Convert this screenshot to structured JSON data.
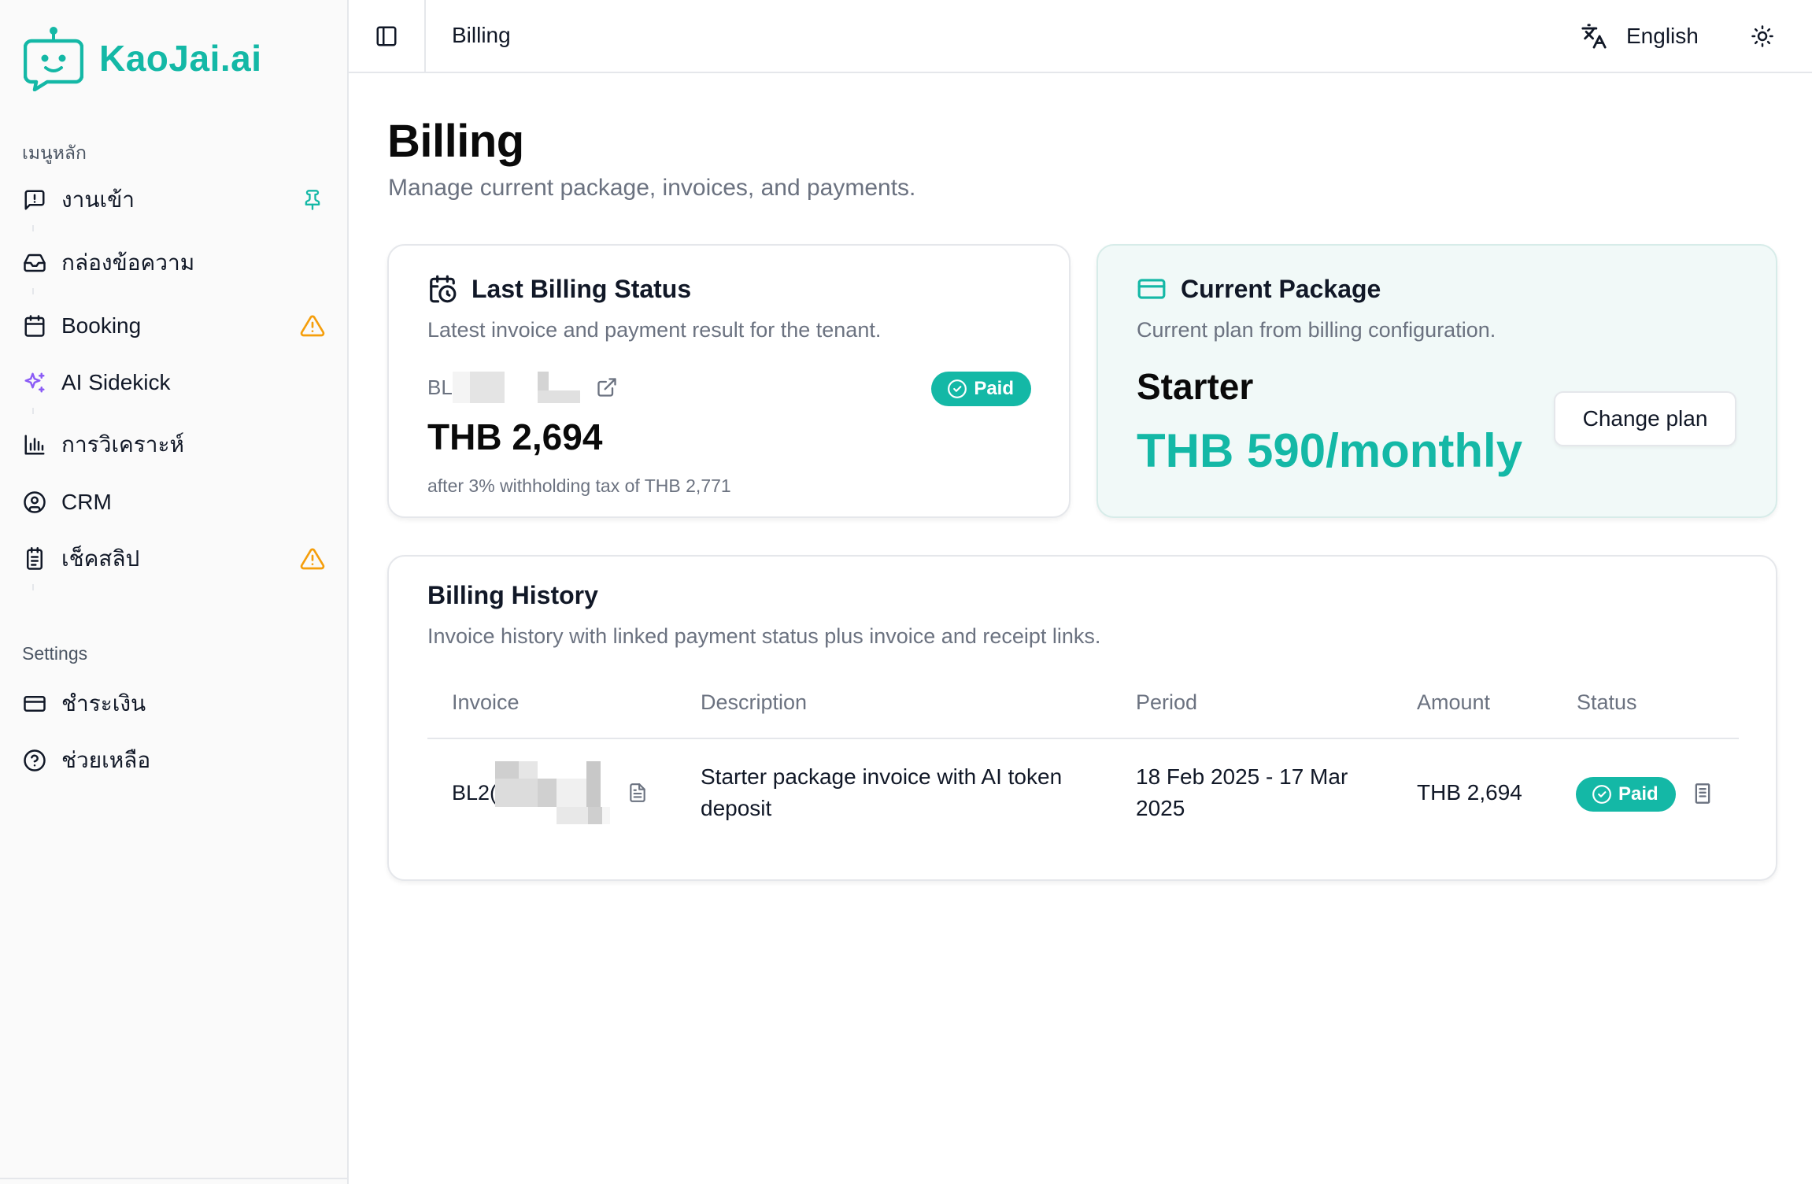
{
  "brand": {
    "name": "KaoJai.ai",
    "accent_color": "#14b8a6"
  },
  "sidebar": {
    "main_section_label": "เมนูหลัก",
    "settings_section_label": "Settings",
    "items": [
      {
        "label": "งานเข้า",
        "icon": "message-alert-icon",
        "badge": "pin-icon"
      },
      {
        "label": "กล่องข้อความ",
        "icon": "inbox-icon"
      },
      {
        "label": "Booking",
        "icon": "calendar-icon",
        "badge": "warning-icon"
      },
      {
        "label": "AI Sidekick",
        "icon": "sparkles-icon"
      },
      {
        "label": "การวิเคราะห์",
        "icon": "bar-chart-icon"
      },
      {
        "label": "CRM",
        "icon": "user-circle-icon"
      },
      {
        "label": "เช็คสลิป",
        "icon": "clipboard-icon",
        "badge": "warning-icon"
      }
    ],
    "settings_items": [
      {
        "label": "ชำระเงิน",
        "icon": "credit-card-icon"
      },
      {
        "label": "ช่วยเหลือ",
        "icon": "help-circle-icon"
      }
    ]
  },
  "topbar": {
    "breadcrumb": "Billing",
    "language": "English"
  },
  "page": {
    "title": "Billing",
    "subtitle": "Manage current package, invoices, and payments."
  },
  "last_billing": {
    "title": "Last Billing Status",
    "description": "Latest invoice and payment result for the tenant.",
    "invoice_ref_visible": "BL2",
    "status": "Paid",
    "amount": "THB 2,694",
    "note": "after 3% withholding tax of THB 2,771"
  },
  "current_package": {
    "title": "Current Package",
    "description": "Current plan from billing configuration.",
    "plan_name": "Starter",
    "price": "THB 590/monthly",
    "change_plan_label": "Change plan"
  },
  "billing_history": {
    "title": "Billing History",
    "description": "Invoice history with linked payment status plus invoice and receipt links.",
    "columns": [
      "Invoice",
      "Description",
      "Period",
      "Amount",
      "Status"
    ],
    "rows": [
      {
        "invoice_visible": "BL2(",
        "description": "Starter package invoice with AI token deposit",
        "period": "18 Feb 2025 - 17 Mar 2025",
        "amount": "THB 2,694",
        "status": "Paid"
      }
    ]
  }
}
